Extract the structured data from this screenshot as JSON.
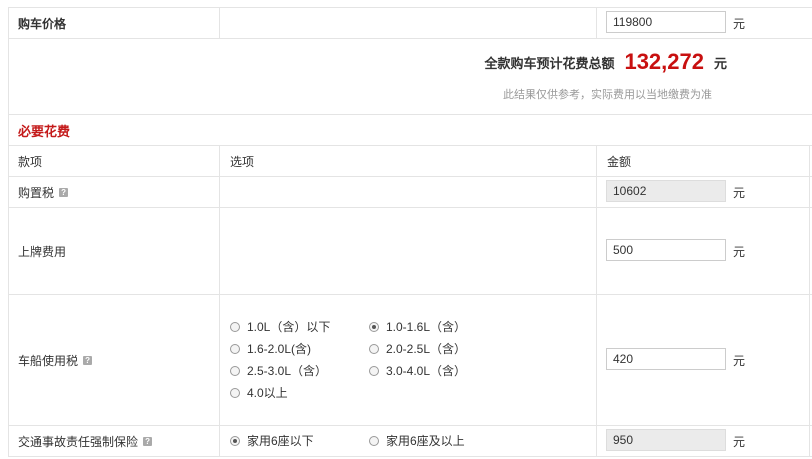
{
  "price_row": {
    "label": "购车价格",
    "value": "119800",
    "unit": "元"
  },
  "summary": {
    "label": "全款购车预计花费总额",
    "total": "132,272",
    "unit": "元",
    "note": "此结果仅供参考，实际费用以当地缴费为准"
  },
  "section": {
    "title": "必要花费"
  },
  "table_header": {
    "col1": "款项",
    "col2": "选项",
    "col3": "金额"
  },
  "rows": {
    "purchase_tax": {
      "label": "购置税",
      "value": "10602",
      "unit": "元"
    },
    "plate_fee": {
      "label": "上牌费用",
      "value": "500",
      "unit": "元"
    },
    "vehicle_tax": {
      "label": "车船使用税",
      "value": "420",
      "unit": "元",
      "options": [
        {
          "label": "1.0L（含）以下",
          "selected": false
        },
        {
          "label": "1.0-1.6L（含）",
          "selected": true
        },
        {
          "label": "1.6-2.0L(含)",
          "selected": false
        },
        {
          "label": "2.0-2.5L（含）",
          "selected": false
        },
        {
          "label": "2.5-3.0L（含）",
          "selected": false
        },
        {
          "label": "3.0-4.0L（含）",
          "selected": false
        },
        {
          "label": "4.0以上",
          "selected": false
        }
      ]
    },
    "insurance": {
      "label": "交通事故责任强制保险",
      "value": "950",
      "unit": "元",
      "options": [
        {
          "label": "家用6座以下",
          "selected": true
        },
        {
          "label": "家用6座及以上",
          "selected": false
        }
      ]
    }
  },
  "help_icon_text": "?"
}
